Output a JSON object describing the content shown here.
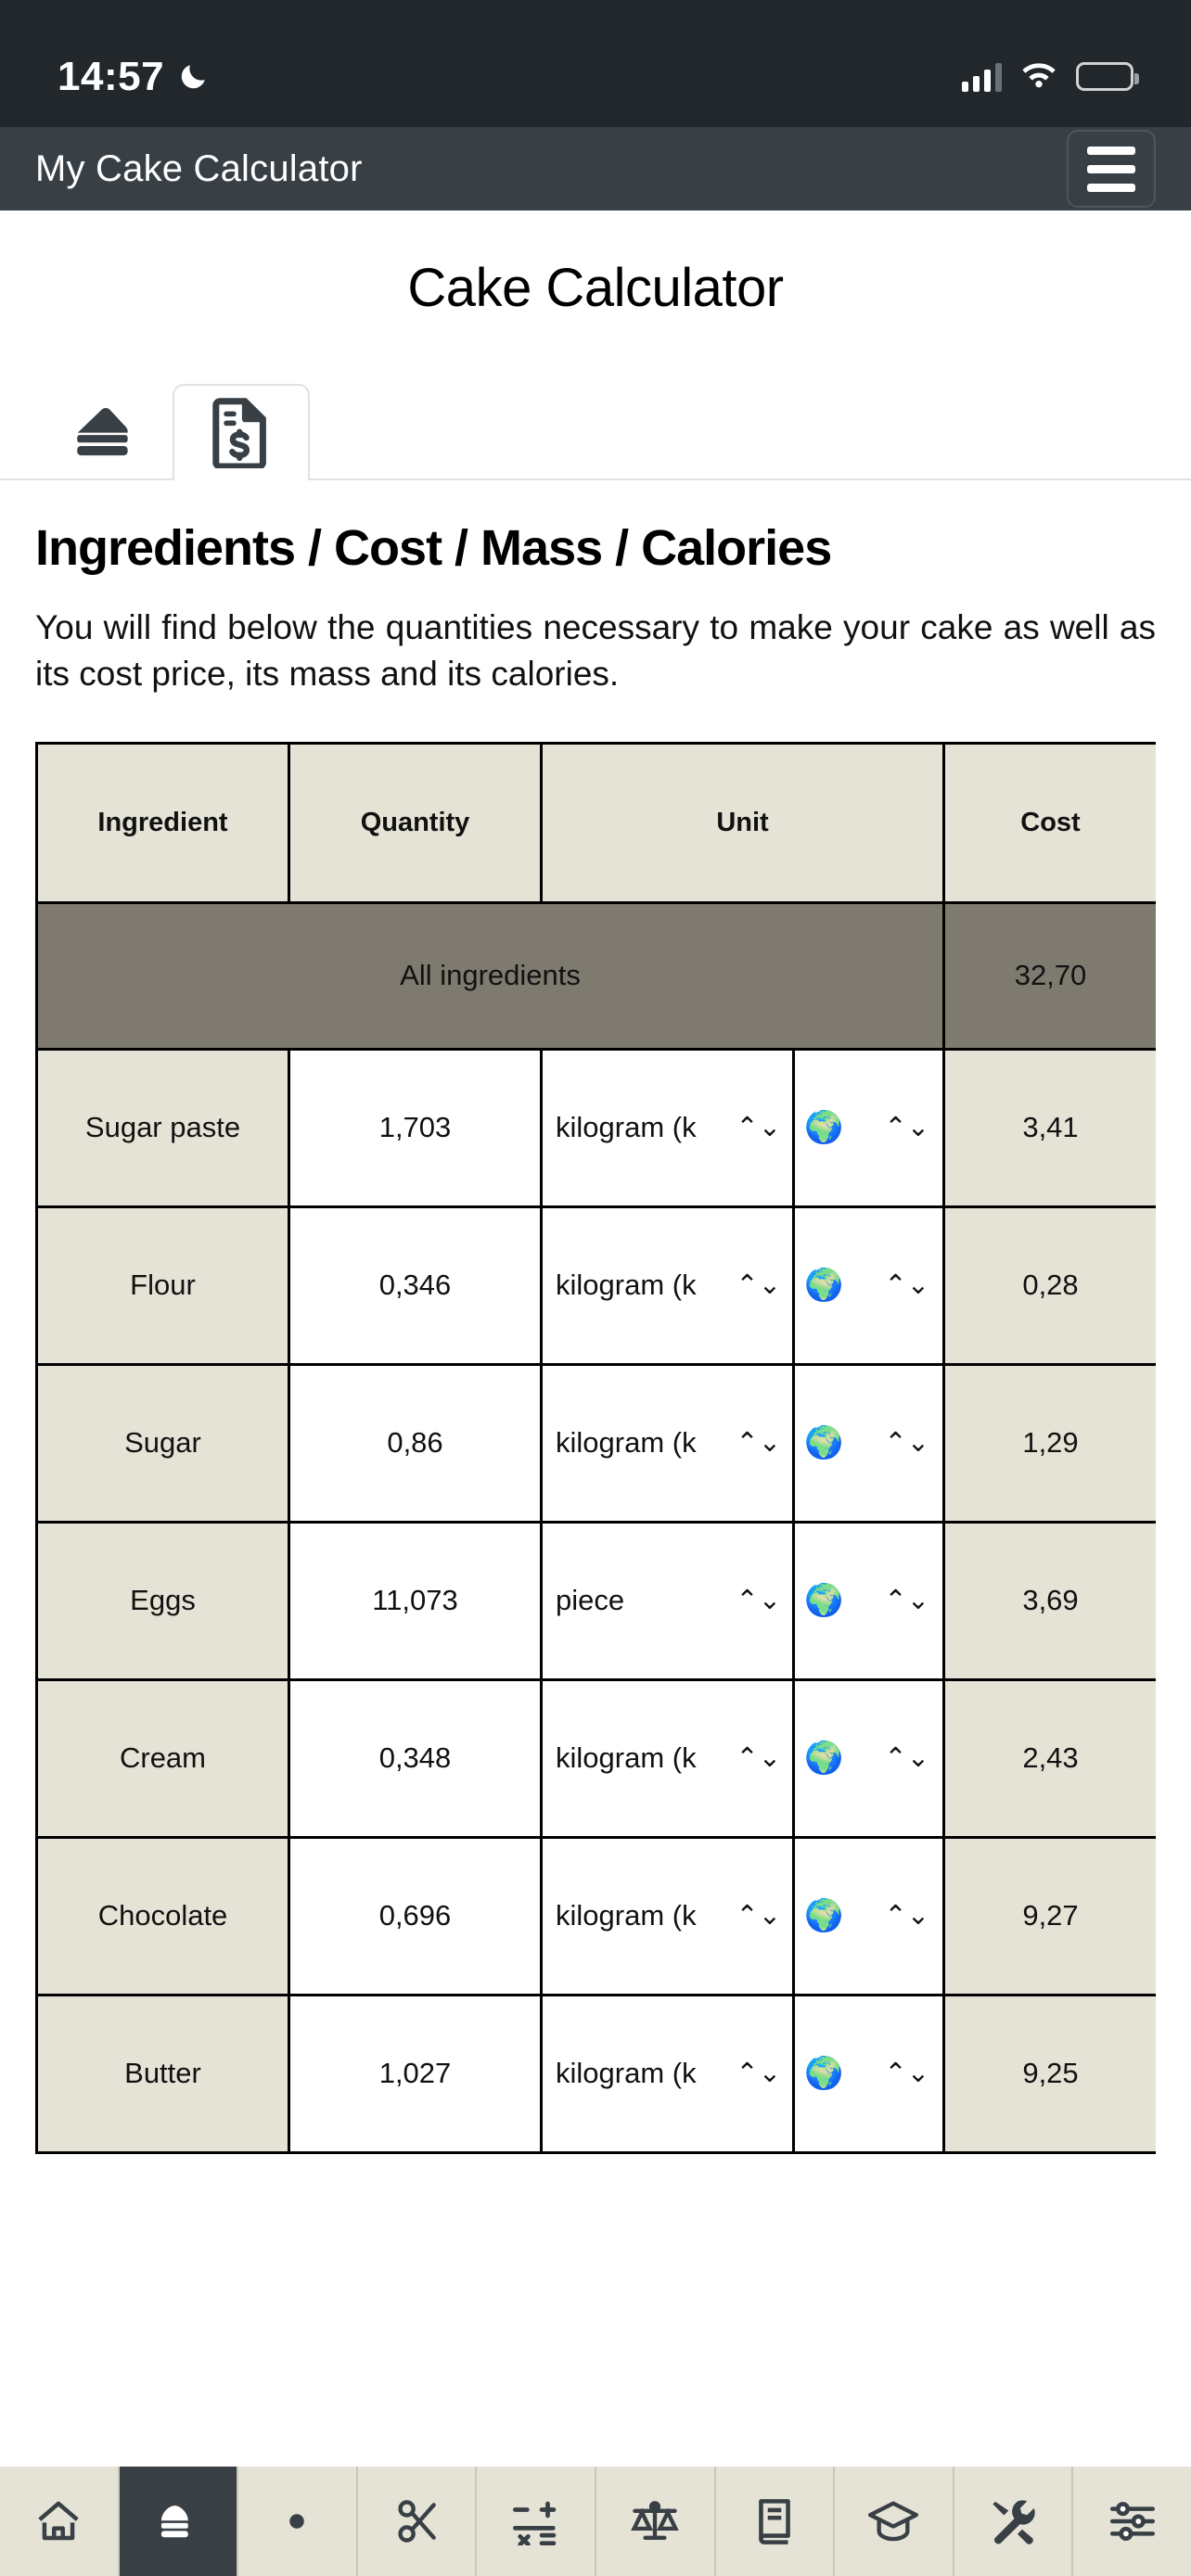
{
  "status_bar": {
    "time": "14:57",
    "dnd_icon": "moon-icon",
    "signal_icon": "cellular-signal-icon",
    "wifi_icon": "wifi-icon",
    "battery_icon": "battery-icon"
  },
  "app_bar": {
    "title": "My Cake Calculator",
    "menu_icon": "hamburger-menu-icon"
  },
  "page": {
    "title": "Cake Calculator",
    "section_title": "Ingredients / Cost / Mass / Calories",
    "section_text": "You will find below the quantities necessary to make your cake as well as its cost price, its mass and its calories."
  },
  "tabs": [
    {
      "icon": "cake-slice-icon",
      "active": false
    },
    {
      "icon": "invoice-dollar-icon",
      "active": true
    }
  ],
  "table": {
    "headers": [
      "Ingredient",
      "Quantity",
      "Unit",
      "Cost"
    ],
    "summary": {
      "label": "All ingredients",
      "cost": "32,70"
    },
    "rows": [
      {
        "ingredient": "Sugar paste",
        "quantity": "1,703",
        "unit": "kilogram (k",
        "origin": "🌍",
        "cost": "3,41"
      },
      {
        "ingredient": "Flour",
        "quantity": "0,346",
        "unit": "kilogram (k",
        "origin": "🌍",
        "cost": "0,28"
      },
      {
        "ingredient": "Sugar",
        "quantity": "0,86",
        "unit": "kilogram (k",
        "origin": "🌍",
        "cost": "1,29"
      },
      {
        "ingredient": "Eggs",
        "quantity": "11,073",
        "unit": "piece",
        "origin": "🌍",
        "cost": "3,69"
      },
      {
        "ingredient": "Cream",
        "quantity": "0,348",
        "unit": "kilogram (k",
        "origin": "🌍",
        "cost": "2,43"
      },
      {
        "ingredient": "Chocolate",
        "quantity": "0,696",
        "unit": "kilogram (k",
        "origin": "🌍",
        "cost": "9,27"
      },
      {
        "ingredient": "Butter",
        "quantity": "1,027",
        "unit": "kilogram (k",
        "origin": "🌍",
        "cost": "9,25"
      }
    ],
    "select_chevron": "⌃⌄"
  },
  "bottom_nav": [
    {
      "icon": "home-icon",
      "active": false
    },
    {
      "icon": "cake-slice-icon",
      "active": true
    },
    {
      "icon": "eye-icon",
      "active": false
    },
    {
      "icon": "scissors-icon",
      "active": false
    },
    {
      "icon": "math-operators-icon",
      "active": false
    },
    {
      "icon": "balance-scale-icon",
      "active": false
    },
    {
      "icon": "book-icon",
      "active": false
    },
    {
      "icon": "graduation-cap-icon",
      "active": false
    },
    {
      "icon": "tools-icon",
      "active": false
    },
    {
      "icon": "sliders-icon",
      "active": false
    }
  ],
  "colors": {
    "status_bar_bg": "#22272c",
    "app_bar_bg": "#383f45",
    "table_accent": "#e5e3d6",
    "summary_bg": "#7e7a70",
    "nav_bg": "#e5e3d6",
    "icon_dark": "#383f45"
  }
}
